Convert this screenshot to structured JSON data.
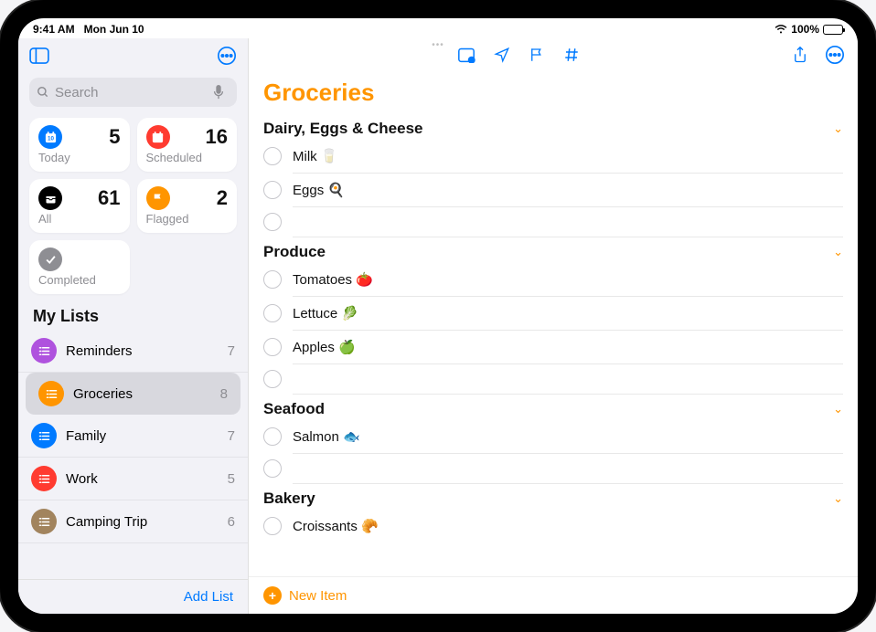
{
  "statusbar": {
    "time": "9:41 AM",
    "date": "Mon Jun 10",
    "battery_pct": "100%"
  },
  "sidebar": {
    "search_placeholder": "Search",
    "cards": {
      "today": {
        "label": "Today",
        "count": "5",
        "color": "#007aff"
      },
      "scheduled": {
        "label": "Scheduled",
        "count": "16",
        "color": "#ff3b30"
      },
      "all": {
        "label": "All",
        "count": "61",
        "color": "#000000"
      },
      "flagged": {
        "label": "Flagged",
        "count": "2",
        "color": "#ff9500"
      },
      "completed": {
        "label": "Completed",
        "color": "#8e8e93"
      }
    },
    "mylists_header": "My Lists",
    "lists": [
      {
        "name": "Reminders",
        "count": "7",
        "color": "#af52de",
        "selected": false
      },
      {
        "name": "Groceries",
        "count": "8",
        "color": "#ff9500",
        "selected": true
      },
      {
        "name": "Family",
        "count": "7",
        "color": "#007aff",
        "selected": false
      },
      {
        "name": "Work",
        "count": "5",
        "color": "#ff3b30",
        "selected": false
      },
      {
        "name": "Camping Trip",
        "count": "6",
        "color": "#a2845e",
        "selected": false
      }
    ],
    "add_list_label": "Add List"
  },
  "main": {
    "title": "Groceries",
    "new_item_label": "New Item",
    "sections": [
      {
        "title": "Dairy, Eggs & Cheese",
        "items": [
          {
            "text": "Milk 🥛"
          },
          {
            "text": "Eggs 🍳"
          },
          {
            "text": ""
          }
        ]
      },
      {
        "title": "Produce",
        "items": [
          {
            "text": "Tomatoes 🍅"
          },
          {
            "text": "Lettuce 🥬"
          },
          {
            "text": "Apples 🍏"
          },
          {
            "text": ""
          }
        ]
      },
      {
        "title": "Seafood",
        "items": [
          {
            "text": "Salmon 🐟"
          },
          {
            "text": ""
          }
        ]
      },
      {
        "title": "Bakery",
        "items": [
          {
            "text": "Croissants 🥐"
          }
        ]
      }
    ]
  }
}
